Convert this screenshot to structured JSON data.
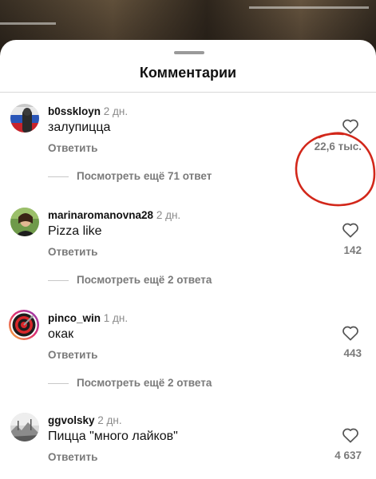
{
  "sheet": {
    "title": "Комментарии"
  },
  "colors": {
    "annotation": "#d2271a",
    "secondary_text": "#7a7a7a",
    "primary_text": "#111111"
  },
  "comments": [
    {
      "username": "b0sskloyn",
      "time": "2 дн.",
      "text": "залупицца",
      "reply_label": "Ответить",
      "likes": "22,6 тыс.",
      "more_replies": "Посмотреть ещё 71 ответ",
      "avatar": "avatar-flag-icon",
      "highlighted": true
    },
    {
      "username": "marinaromanovna28",
      "time": "2 дн.",
      "text": "Pizza like",
      "reply_label": "Ответить",
      "likes": "142",
      "more_replies": "Посмотреть ещё 2 ответа",
      "avatar": "avatar-photo-icon"
    },
    {
      "username": "pinco_win",
      "time": "1 дн.",
      "text": "окак",
      "reply_label": "Ответить",
      "likes": "443",
      "more_replies": "Посмотреть ещё 2 ответа",
      "avatar": "avatar-target-icon"
    },
    {
      "username": "ggvolsky",
      "time": "2 дн.",
      "text": "Пицца \"много лайков\"",
      "reply_label": "Ответить",
      "likes": "4 637",
      "avatar": "avatar-landscape-icon"
    }
  ]
}
